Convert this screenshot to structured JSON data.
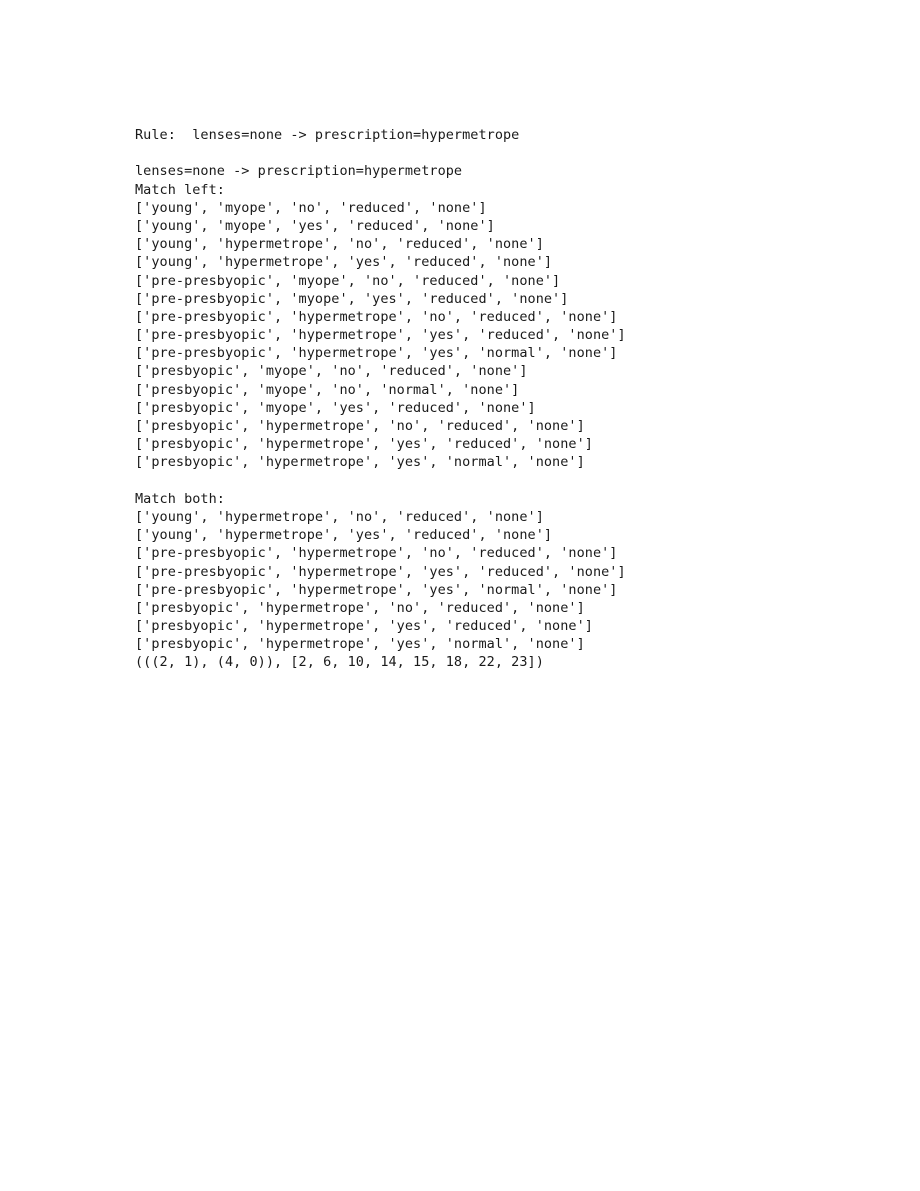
{
  "document": {
    "background_color": "#ffffff",
    "text_color": "#1a1a1a",
    "header": {
      "label": "Rule:",
      "full_line": "Rule:  lenses=none -> prescription=hypermetrope"
    },
    "rule": {
      "antecedent": "lenses=none",
      "arrow": "->",
      "consequent": "prescription=hypermetrope",
      "full_line": "lenses=none -> prescription=hypermetrope"
    },
    "sections": [
      {
        "title": "Match left:",
        "rows": [
          "['young', 'myope', 'no', 'reduced', 'none']",
          "['young', 'myope', 'yes', 'reduced', 'none']",
          "['young', 'hypermetrope', 'no', 'reduced', 'none']",
          "['young', 'hypermetrope', 'yes', 'reduced', 'none']",
          "['pre-presbyopic', 'myope', 'no', 'reduced', 'none']",
          "['pre-presbyopic', 'myope', 'yes', 'reduced', 'none']",
          "['pre-presbyopic', 'hypermetrope', 'no', 'reduced', 'none']",
          "['pre-presbyopic', 'hypermetrope', 'yes', 'reduced', 'none']",
          "['pre-presbyopic', 'hypermetrope', 'yes', 'normal', 'none']",
          "['presbyopic', 'myope', 'no', 'reduced', 'none']",
          "['presbyopic', 'myope', 'no', 'normal', 'none']",
          "['presbyopic', 'myope', 'yes', 'reduced', 'none']",
          "['presbyopic', 'hypermetrope', 'no', 'reduced', 'none']",
          "['presbyopic', 'hypermetrope', 'yes', 'reduced', 'none']",
          "['presbyopic', 'hypermetrope', 'yes', 'normal', 'none']"
        ]
      },
      {
        "title": "Match both:",
        "rows": [
          "['young', 'hypermetrope', 'no', 'reduced', 'none']",
          "['young', 'hypermetrope', 'yes', 'reduced', 'none']",
          "['pre-presbyopic', 'hypermetrope', 'no', 'reduced', 'none']",
          "['pre-presbyopic', 'hypermetrope', 'yes', 'reduced', 'none']",
          "['pre-presbyopic', 'hypermetrope', 'yes', 'normal', 'none']",
          "['presbyopic', 'hypermetrope', 'no', 'reduced', 'none']",
          "['presbyopic', 'hypermetrope', 'yes', 'reduced', 'none']",
          "['presbyopic', 'hypermetrope', 'yes', 'normal', 'none']"
        ]
      }
    ],
    "summary_tuple": "(((2, 1), (4, 0)), [2, 6, 10, 14, 15, 18, 22, 23])"
  }
}
